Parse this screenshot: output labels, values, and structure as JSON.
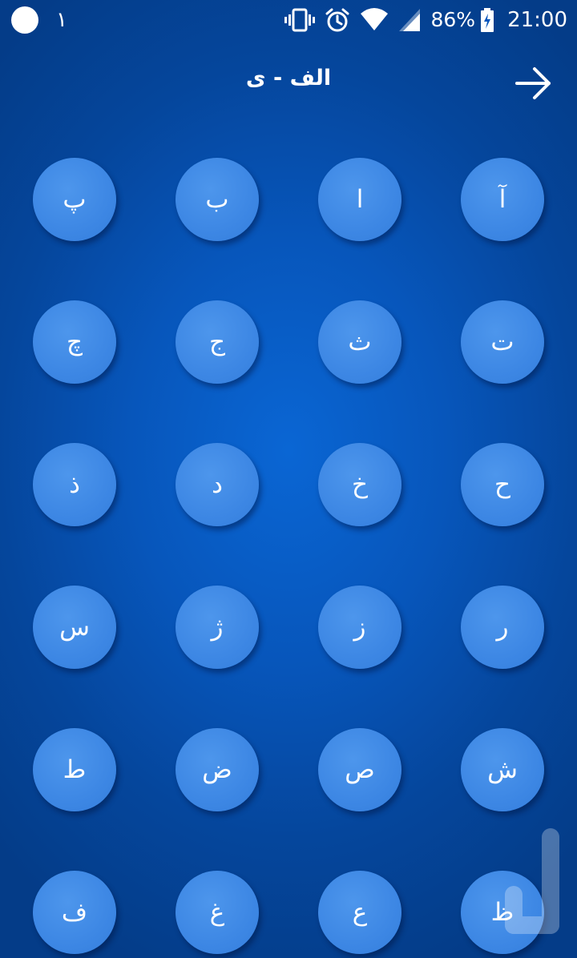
{
  "status_bar": {
    "notification_count": "١",
    "battery_percent": "86%",
    "time": "21:00",
    "icons": [
      "vibrate-icon",
      "alarm-icon",
      "wifi-icon",
      "signal-icon",
      "battery-charging-icon"
    ]
  },
  "header": {
    "title": "الف - ی",
    "forward_icon": "arrow-right-icon"
  },
  "letters": [
    [
      "آ",
      "ا",
      "ب",
      "پ"
    ],
    [
      "ت",
      "ث",
      "ج",
      "چ"
    ],
    [
      "ح",
      "خ",
      "د",
      "ذ"
    ],
    [
      "ر",
      "ز",
      "ژ",
      "س"
    ],
    [
      "ش",
      "ص",
      "ض",
      "ط"
    ],
    [
      "ظ",
      "ع",
      "غ",
      "ف"
    ]
  ],
  "colors": {
    "background": "#0756bb",
    "button": "#3d87e4",
    "text": "#ffffff"
  }
}
